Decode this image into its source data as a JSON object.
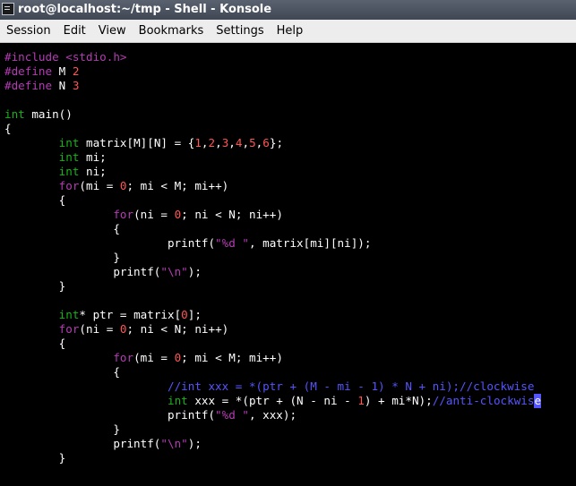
{
  "window": {
    "title": "root@localhost:~/tmp - Shell - Konsole"
  },
  "menu": [
    "Session",
    "Edit",
    "View",
    "Bookmarks",
    "Settings",
    "Help"
  ],
  "colors": {
    "preprocessor": "#b53bb5",
    "type": "#18b218",
    "keyword": "#b53bb5",
    "number": "#ff5555",
    "string": "#b53bb5",
    "comment": "#5555ff",
    "text": "#ffffff",
    "background": "#000000"
  },
  "terminal": {
    "lines": [
      [
        [
          "pre",
          "#include "
        ],
        [
          "inc",
          "<stdio.h>"
        ]
      ],
      [
        [
          "pre",
          "#define "
        ],
        [
          "plain",
          "M "
        ],
        [
          "num",
          "2"
        ]
      ],
      [
        [
          "pre",
          "#define "
        ],
        [
          "plain",
          "N "
        ],
        [
          "num",
          "3"
        ]
      ],
      [],
      [
        [
          "type",
          "int"
        ],
        [
          "plain",
          " main()"
        ]
      ],
      [
        [
          "plain",
          "{"
        ]
      ],
      [
        [
          "plain",
          "        "
        ],
        [
          "type",
          "int"
        ],
        [
          "plain",
          " matrix[M][N] = {"
        ],
        [
          "num",
          "1"
        ],
        [
          "plain",
          ","
        ],
        [
          "num",
          "2"
        ],
        [
          "plain",
          ","
        ],
        [
          "num",
          "3"
        ],
        [
          "plain",
          ","
        ],
        [
          "num",
          "4"
        ],
        [
          "plain",
          ","
        ],
        [
          "num",
          "5"
        ],
        [
          "plain",
          ","
        ],
        [
          "num",
          "6"
        ],
        [
          "plain",
          "};"
        ]
      ],
      [
        [
          "plain",
          "        "
        ],
        [
          "type",
          "int"
        ],
        [
          "plain",
          " mi;"
        ]
      ],
      [
        [
          "plain",
          "        "
        ],
        [
          "type",
          "int"
        ],
        [
          "plain",
          " ni;"
        ]
      ],
      [
        [
          "plain",
          "        "
        ],
        [
          "kw",
          "for"
        ],
        [
          "plain",
          "(mi = "
        ],
        [
          "num",
          "0"
        ],
        [
          "plain",
          "; mi < M; mi++)"
        ]
      ],
      [
        [
          "plain",
          "        {"
        ]
      ],
      [
        [
          "plain",
          "                "
        ],
        [
          "kw",
          "for"
        ],
        [
          "plain",
          "(ni = "
        ],
        [
          "num",
          "0"
        ],
        [
          "plain",
          "; ni < N; ni++)"
        ]
      ],
      [
        [
          "plain",
          "                {"
        ]
      ],
      [
        [
          "plain",
          "                        printf("
        ],
        [
          "str",
          "\"%d \""
        ],
        [
          "plain",
          ", matrix[mi][ni]);"
        ]
      ],
      [
        [
          "plain",
          "                }"
        ]
      ],
      [
        [
          "plain",
          "                printf("
        ],
        [
          "str",
          "\"\\n\""
        ],
        [
          "plain",
          ");"
        ]
      ],
      [
        [
          "plain",
          "        }"
        ]
      ],
      [],
      [
        [
          "plain",
          "        "
        ],
        [
          "type",
          "int"
        ],
        [
          "plain",
          "* ptr = matrix["
        ],
        [
          "num",
          "0"
        ],
        [
          "plain",
          "];"
        ]
      ],
      [
        [
          "plain",
          "        "
        ],
        [
          "kw",
          "for"
        ],
        [
          "plain",
          "(ni = "
        ],
        [
          "num",
          "0"
        ],
        [
          "plain",
          "; ni < N; ni++)"
        ]
      ],
      [
        [
          "plain",
          "        {"
        ]
      ],
      [
        [
          "plain",
          "                "
        ],
        [
          "kw",
          "for"
        ],
        [
          "plain",
          "(mi = "
        ],
        [
          "num",
          "0"
        ],
        [
          "plain",
          "; mi < M; mi++)"
        ]
      ],
      [
        [
          "plain",
          "                {"
        ]
      ],
      [
        [
          "plain",
          "                        "
        ],
        [
          "cmt",
          "//int xxx = *(ptr + (M - mi - 1) * N + ni);//clockwise"
        ]
      ],
      [
        [
          "plain",
          "                        "
        ],
        [
          "type",
          "int"
        ],
        [
          "plain",
          " xxx = *(ptr + (N - ni - "
        ],
        [
          "num",
          "1"
        ],
        [
          "plain",
          ") + mi*N);"
        ],
        [
          "cmt",
          "//anti-clockwis"
        ],
        [
          "cursor",
          "e"
        ]
      ],
      [
        [
          "plain",
          "                        printf("
        ],
        [
          "str",
          "\"%d \""
        ],
        [
          "plain",
          ", xxx);"
        ]
      ],
      [
        [
          "plain",
          "                }"
        ]
      ],
      [
        [
          "plain",
          "                printf("
        ],
        [
          "str",
          "\"\\n\""
        ],
        [
          "plain",
          ");"
        ]
      ],
      [
        [
          "plain",
          "        }"
        ]
      ]
    ]
  }
}
